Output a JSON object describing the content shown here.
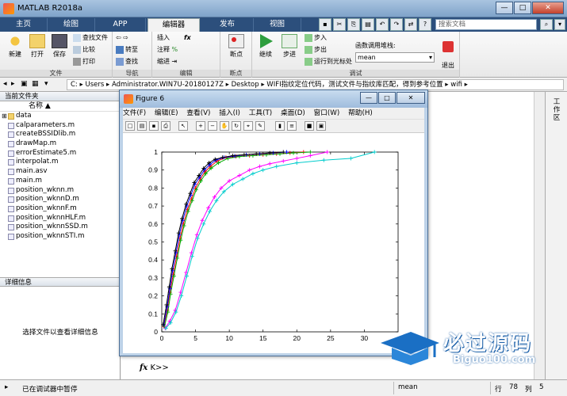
{
  "app": {
    "title": "MATLAB R2018a"
  },
  "window_controls": {
    "minimize": "—",
    "maximize": "□",
    "close": "✕"
  },
  "tabs": [
    {
      "label": "主页"
    },
    {
      "label": "绘图"
    },
    {
      "label": "APP"
    },
    {
      "label": "编辑器"
    },
    {
      "label": "发布"
    },
    {
      "label": "视图"
    }
  ],
  "search": {
    "placeholder": "搜索文档"
  },
  "ribbon": {
    "file": {
      "new_label": "新建",
      "open_label": "打开",
      "save_label": "保存",
      "find_file_label": "查找文件",
      "compare_label": "比较",
      "print_label": "打印",
      "group_label": "文件"
    },
    "navigate": {
      "goto_label": "转至",
      "find_label": "查找",
      "group_label": "导航"
    },
    "edit": {
      "insert_label": "插入",
      "comment_label": "注释",
      "indent_label": "缩进",
      "fx_label": "fx",
      "group_label": "编辑"
    },
    "breakpoints": {
      "label": "断点",
      "group_label": "断点"
    },
    "debug": {
      "continue_label": "继续",
      "step_label": "步进",
      "step_in_label": "步入",
      "step_out_label": "步出",
      "run_to_cursor_label": "运行到光标处",
      "stack_label": "函数调用堆栈:",
      "stack_value": "mean",
      "quit_label": "退出\n调试",
      "group_label": "调试"
    }
  },
  "address": {
    "path": [
      "C:",
      "Users",
      "Administrator.WIN7U-20180127Z",
      "Desktop",
      "WIFI指纹定位代码，测试文件与指纹库匹配，得到参考位置",
      "wifi"
    ]
  },
  "left_pane": {
    "title": "当前文件夹",
    "column_name": "名称 ▲",
    "files": [
      {
        "name": "data",
        "type": "folder"
      },
      {
        "name": "calparameters.m",
        "type": "m"
      },
      {
        "name": "createBSSIDlib.m",
        "type": "m"
      },
      {
        "name": "drawMap.m",
        "type": "m"
      },
      {
        "name": "errorEstimate5.m",
        "type": "m"
      },
      {
        "name": "interpolat.m",
        "type": "m"
      },
      {
        "name": "main.asv",
        "type": "asv"
      },
      {
        "name": "main.m",
        "type": "m"
      },
      {
        "name": "position_wknn.m",
        "type": "m"
      },
      {
        "name": "position_wknnD.m",
        "type": "m"
      },
      {
        "name": "position_wknnF.m",
        "type": "m"
      },
      {
        "name": "position_wknnHLF.m",
        "type": "m"
      },
      {
        "name": "position_wknnSSD.m",
        "type": "m"
      },
      {
        "name": "position_wknnSTI.m",
        "type": "m"
      }
    ],
    "details_title": "详细信息",
    "details_hint": "选择文件以查看详细信息"
  },
  "right_panel": {
    "vertical_text": "工作区"
  },
  "command": {
    "prompt": "K>>",
    "fx": "fx"
  },
  "status": {
    "left": "已在调试器中暂停",
    "function": "mean",
    "row_label": "行",
    "row": "78",
    "col_label": "列",
    "col": "5"
  },
  "figure": {
    "title": "Figure 6",
    "menu": [
      "文件(F)",
      "编辑(E)",
      "查看(V)",
      "插入(I)",
      "工具(T)",
      "桌面(D)",
      "窗口(W)",
      "帮助(H)"
    ]
  },
  "watermark": {
    "cn": "必过源码",
    "en": "Biguo100.com"
  },
  "chart_data": {
    "type": "line",
    "title": "",
    "xlabel": "",
    "ylabel": "",
    "xlim": [
      0,
      35
    ],
    "ylim": [
      0,
      1
    ],
    "xticks": [
      0,
      5,
      10,
      15,
      20,
      25,
      30
    ],
    "yticks": [
      0,
      0.1,
      0.2,
      0.3,
      0.4,
      0.5,
      0.6,
      0.7,
      0.8,
      0.9,
      1
    ],
    "grid": false,
    "series": [
      {
        "color": "#ff0000",
        "x": [
          0.3,
          0.8,
          1.2,
          1.7,
          2.2,
          2.7,
          3.2,
          3.8,
          4.4,
          5.0,
          5.7,
          6.4,
          7.2,
          8.2,
          9.5,
          11,
          13,
          15,
          17,
          19,
          21
        ],
        "y": [
          0.03,
          0.12,
          0.22,
          0.32,
          0.42,
          0.52,
          0.6,
          0.68,
          0.74,
          0.8,
          0.85,
          0.89,
          0.92,
          0.95,
          0.97,
          0.975,
          0.98,
          0.985,
          0.99,
          0.995,
          1.0
        ]
      },
      {
        "color": "#00aa00",
        "x": [
          0.4,
          0.9,
          1.3,
          1.8,
          2.3,
          2.8,
          3.3,
          3.9,
          4.5,
          5.1,
          5.8,
          6.5,
          7.3,
          8.4,
          9.8,
          11.5,
          13.5,
          15.5,
          17.5,
          19.5,
          22
        ],
        "y": [
          0.03,
          0.11,
          0.21,
          0.31,
          0.41,
          0.51,
          0.59,
          0.67,
          0.73,
          0.79,
          0.84,
          0.88,
          0.91,
          0.94,
          0.965,
          0.975,
          0.98,
          0.985,
          0.99,
          0.995,
          1.0
        ]
      },
      {
        "color": "#0000ff",
        "x": [
          0.3,
          0.8,
          1.2,
          1.6,
          2.1,
          2.6,
          3.1,
          3.7,
          4.3,
          4.9,
          5.6,
          6.3,
          7.1,
          8.0,
          9.2,
          10.8,
          12.5,
          14.5,
          16.5,
          18.5
        ],
        "y": [
          0.04,
          0.14,
          0.24,
          0.34,
          0.44,
          0.54,
          0.62,
          0.7,
          0.76,
          0.82,
          0.86,
          0.9,
          0.93,
          0.955,
          0.97,
          0.978,
          0.985,
          0.99,
          0.995,
          1.0
        ]
      },
      {
        "color": "#000000",
        "x": [
          0.2,
          0.7,
          1.1,
          1.5,
          2.0,
          2.5,
          3.0,
          3.6,
          4.2,
          4.8,
          5.5,
          6.2,
          7.0,
          7.9,
          9.0,
          10.5,
          12.2,
          14.0,
          16.0,
          18.0
        ],
        "y": [
          0.04,
          0.15,
          0.25,
          0.35,
          0.45,
          0.55,
          0.63,
          0.71,
          0.77,
          0.83,
          0.87,
          0.91,
          0.94,
          0.96,
          0.97,
          0.98,
          0.985,
          0.99,
          0.995,
          1.0
        ]
      },
      {
        "color": "#ff00ff",
        "x": [
          0.5,
          1.2,
          2.0,
          2.8,
          3.6,
          4.4,
          5.2,
          6.0,
          6.9,
          7.8,
          8.8,
          10,
          11.5,
          13,
          14.5,
          16,
          18,
          20,
          22,
          24.5
        ],
        "y": [
          0.02,
          0.06,
          0.12,
          0.22,
          0.33,
          0.44,
          0.54,
          0.62,
          0.69,
          0.75,
          0.8,
          0.84,
          0.87,
          0.9,
          0.92,
          0.935,
          0.95,
          0.965,
          0.98,
          1.0
        ]
      },
      {
        "color": "#00cccc",
        "x": [
          0.6,
          1.3,
          2.1,
          2.9,
          3.7,
          4.5,
          5.3,
          6.2,
          7.1,
          8.1,
          9.2,
          10.5,
          12,
          13.5,
          15,
          17,
          20,
          24,
          28,
          31.5
        ],
        "y": [
          0.02,
          0.05,
          0.11,
          0.2,
          0.31,
          0.42,
          0.52,
          0.6,
          0.67,
          0.73,
          0.78,
          0.82,
          0.85,
          0.88,
          0.9,
          0.92,
          0.94,
          0.955,
          0.965,
          1.0
        ]
      }
    ]
  }
}
